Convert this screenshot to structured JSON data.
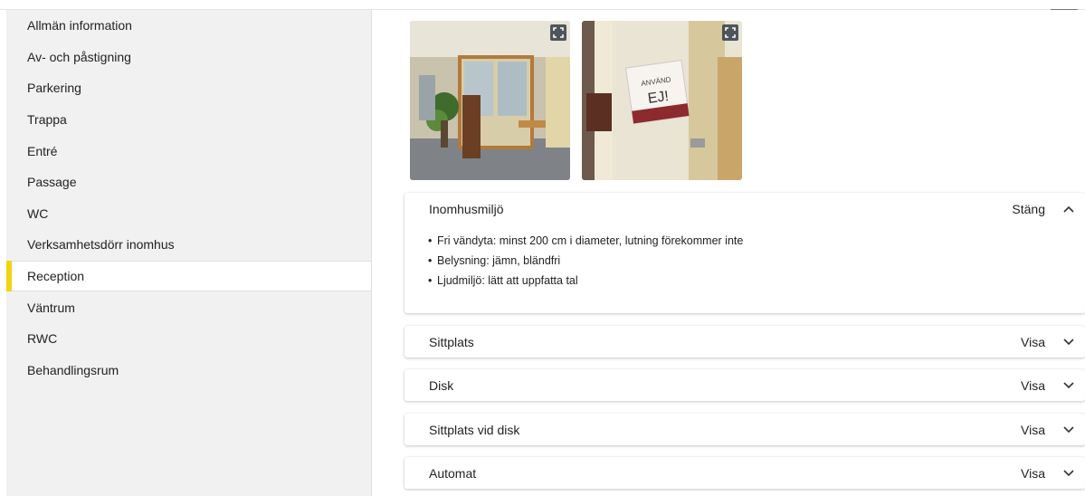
{
  "sidebar": {
    "items": [
      {
        "label": "Allmän information"
      },
      {
        "label": "Av- och påstigning"
      },
      {
        "label": "Parkering"
      },
      {
        "label": "Trappa"
      },
      {
        "label": "Entré"
      },
      {
        "label": "Passage"
      },
      {
        "label": "WC"
      },
      {
        "label": "Verksamhetsdörr inomhus"
      },
      {
        "label": "Reception",
        "active": true
      },
      {
        "label": "Väntrum"
      },
      {
        "label": "RWC"
      },
      {
        "label": "Behandlingsrum"
      }
    ]
  },
  "photos": [
    {
      "alt_icon": "expand-icon"
    },
    {
      "alt_icon": "expand-icon",
      "sign_text_1": "ANVÄND",
      "sign_text_2": "EJ!"
    }
  ],
  "sections": [
    {
      "title": "Inomhusmiljö",
      "toggle": "Stäng",
      "expanded": true,
      "items": [
        "Fri vändyta: minst 200 cm i diameter, lutning förekommer inte",
        "Belysning: jämn, bländfri",
        "Ljudmiljö: lätt att uppfatta tal"
      ]
    },
    {
      "title": "Sittplats",
      "toggle": "Visa",
      "expanded": false
    },
    {
      "title": "Disk",
      "toggle": "Visa",
      "expanded": false
    },
    {
      "title": "Sittplats vid disk",
      "toggle": "Visa",
      "expanded": false
    },
    {
      "title": "Automat",
      "toggle": "Visa",
      "expanded": false
    }
  ],
  "colors": {
    "active_marker": "#f2d40f",
    "sidebar_bg": "#f1f1f1"
  }
}
